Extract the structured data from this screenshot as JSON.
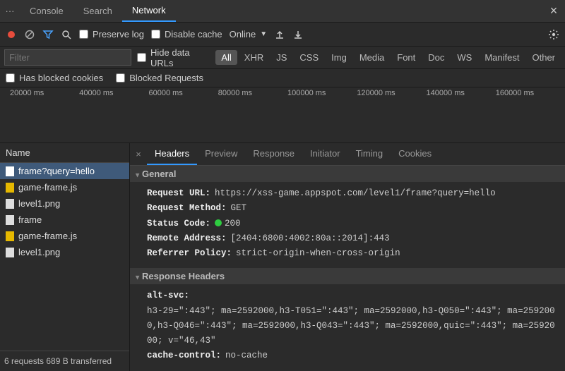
{
  "tabs": {
    "items": [
      "Console",
      "Search",
      "Network"
    ],
    "active": 2
  },
  "toolbar": {
    "preserve_log": "Preserve log",
    "disable_cache": "Disable cache",
    "throttle": "Online"
  },
  "filter": {
    "placeholder": "Filter",
    "hide_data_urls": "Hide data URLs",
    "types": [
      "All",
      "XHR",
      "JS",
      "CSS",
      "Img",
      "Media",
      "Font",
      "Doc",
      "WS",
      "Manifest",
      "Other"
    ],
    "selected": 0,
    "has_blocked_cookies": "Has blocked cookies",
    "blocked_requests": "Blocked Requests"
  },
  "timeline_ticks": [
    "20000 ms",
    "40000 ms",
    "60000 ms",
    "80000 ms",
    "100000 ms",
    "120000 ms",
    "140000 ms",
    "160000 ms"
  ],
  "list": {
    "header": "Name",
    "items": [
      {
        "name": "frame?query=hello",
        "icon": "doc"
      },
      {
        "name": "game-frame.js",
        "icon": "js"
      },
      {
        "name": "level1.png",
        "icon": "doc"
      },
      {
        "name": "frame",
        "icon": "doc"
      },
      {
        "name": "game-frame.js",
        "icon": "js"
      },
      {
        "name": "level1.png",
        "icon": "doc"
      }
    ],
    "selected": 0,
    "status": "6 requests  689 B transferred"
  },
  "detail_tabs": {
    "items": [
      "Headers",
      "Preview",
      "Response",
      "Initiator",
      "Timing",
      "Cookies"
    ],
    "active": 0
  },
  "headers": {
    "general_label": "General",
    "general": [
      {
        "k": "Request URL:",
        "v": "https://xss-game.appspot.com/level1/frame?query=hello"
      },
      {
        "k": "Request Method:",
        "v": "GET"
      },
      {
        "k": "Status Code:",
        "v": "200",
        "status": true
      },
      {
        "k": "Remote Address:",
        "v": "[2404:6800:4002:80a::2014]:443"
      },
      {
        "k": "Referrer Policy:",
        "v": "strict-origin-when-cross-origin"
      }
    ],
    "response_label": "Response Headers",
    "response": [
      {
        "k": "alt-svc:",
        "v": "h3-29=\":443\"; ma=2592000,h3-T051=\":443\"; ma=2592000,h3-Q050=\":443\"; ma=2592000,h3-Q046=\":443\"; ma=2592000,h3-Q043=\":443\"; ma=2592000,quic=\":443\"; ma=2592000; v=\"46,43\""
      },
      {
        "k": "cache-control:",
        "v": "no-cache"
      }
    ]
  }
}
